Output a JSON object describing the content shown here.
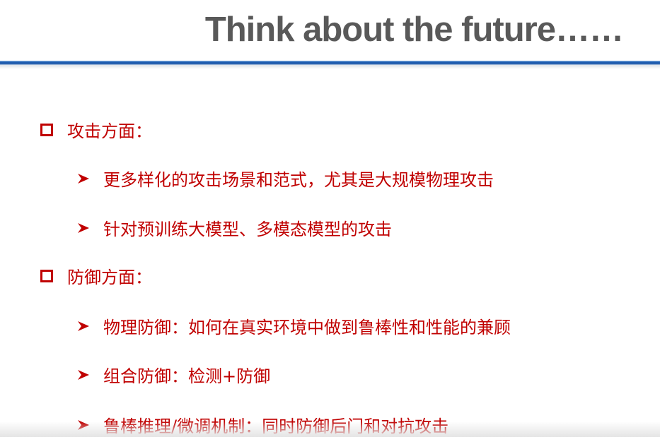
{
  "title": "Think about the future……",
  "colors": {
    "text": "#c00000",
    "title": "#595959",
    "rule": "#1f5fb4"
  },
  "sections": [
    {
      "label": "攻击方面：",
      "bullet_icon": "square-bullet",
      "items": [
        "更多样化的攻击场景和范式，尤其是大规模物理攻击",
        "针对预训练大模型、多模态模型的攻击"
      ]
    },
    {
      "label": "防御方面：",
      "bullet_icon": "square-bullet",
      "items": [
        "物理防御：如何在真实环境中做到鲁棒性和性能的兼顾",
        "组合防御：检测+防御",
        "鲁棒推理/微调机制：同时防御后门和对抗攻击"
      ]
    }
  ]
}
